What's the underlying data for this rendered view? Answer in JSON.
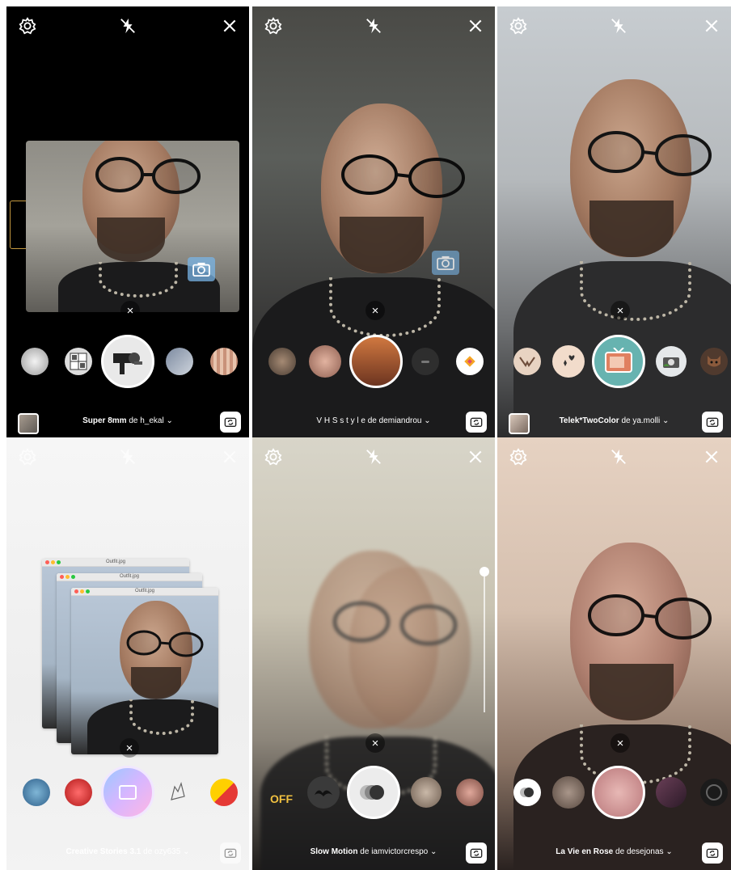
{
  "panels": [
    {
      "id": "super-8mm",
      "effect_name": "Super 8mm",
      "connector": "de",
      "author": "h_ekal",
      "chevron": "⌄"
    },
    {
      "id": "vhs-style",
      "effect_name": "V H S  s t y l e",
      "connector": "de",
      "author": "demiandrou",
      "chevron": "⌄"
    },
    {
      "id": "telek-twocolor",
      "effect_name": "Telek*TwoColor",
      "connector": "de",
      "author": "ya.molli",
      "chevron": "⌄"
    },
    {
      "id": "creative-stories",
      "effect_name": "Creative Stories 3.1",
      "connector": "de",
      "author": "ozy635",
      "chevron": "⌄",
      "windows": [
        {
          "title": "Outfit.jpg"
        },
        {
          "title": "Outfit.jpg"
        },
        {
          "title": "Outfit.jpg"
        }
      ]
    },
    {
      "id": "slow-motion",
      "effect_name": "Slow Motion",
      "connector": "de",
      "author": "iamvictorcrespo",
      "chevron": "⌄",
      "off_label": "OFF"
    },
    {
      "id": "la-vie-en-rose",
      "effect_name": "La Vie en Rose",
      "connector": "de",
      "author": "desejonas",
      "chevron": "⌄"
    }
  ],
  "icons": {
    "settings": "settings-icon",
    "flash": "flash-off-icon",
    "close": "close-icon",
    "flip": "flip-camera-icon",
    "remove": "remove-effect-icon",
    "x_glyph": "×"
  },
  "colors": {
    "selected_ring": "#ffffff",
    "off_label": "#f0c040",
    "cam_badge": "#78b4e6"
  }
}
